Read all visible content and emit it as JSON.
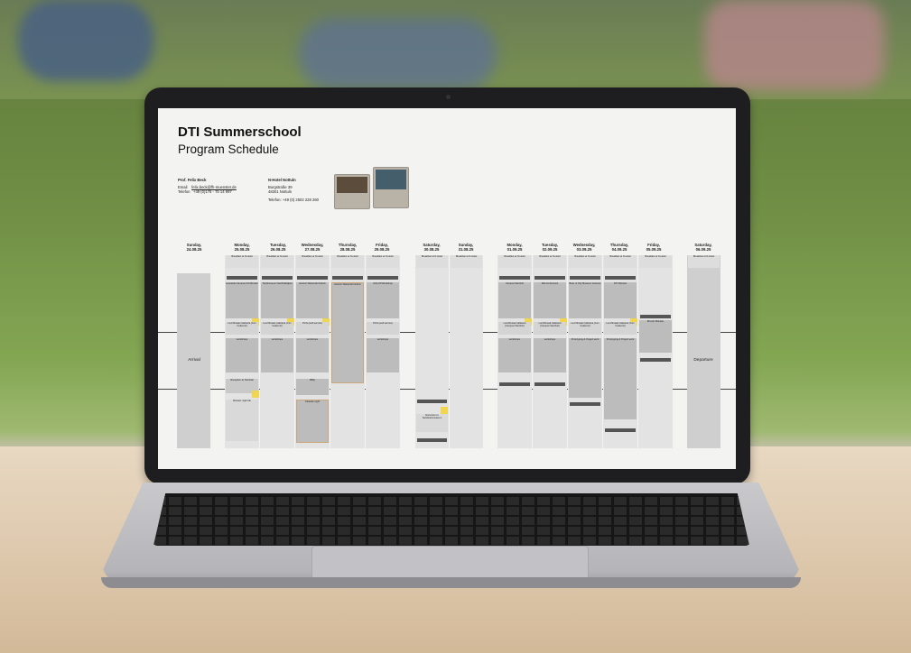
{
  "schedule": {
    "title": "DTI Summerschool",
    "subtitle": "Program Schedule",
    "contact": {
      "name": "Prof. Felix Beck",
      "email_label": "Email",
      "email": "felix.beck@fh-muenster.de",
      "phone_label": "Telefon",
      "phone": "+49 (0)175 - 75 14 997"
    },
    "hotel": {
      "name": "N-Hotel Nottuln",
      "street": "Burgstraße 39",
      "city": "48301 Nottuln",
      "phone": "Telefon: +49 (0) 2502 228 260"
    },
    "days": [
      {
        "label": "Sunday,",
        "date": "24.08.25"
      },
      {
        "label": "Monday,",
        "date": "25.08.25"
      },
      {
        "label": "Tuesday,",
        "date": "26.08.25"
      },
      {
        "label": "Wednesday,",
        "date": "27.08.25"
      },
      {
        "label": "Thursday,",
        "date": "28.08.25"
      },
      {
        "label": "Friday,",
        "date": "29.08.25"
      },
      {
        "label": "Saturday,",
        "date": "30.08.25"
      },
      {
        "label": "Sunday,",
        "date": "31.08.25"
      },
      {
        "label": "Monday,",
        "date": "01.09.25"
      },
      {
        "label": "Tuesday,",
        "date": "02.09.25"
      },
      {
        "label": "Wednesday,",
        "date": "03.09.25"
      },
      {
        "label": "Thursday,",
        "date": "04.09.25"
      },
      {
        "label": "Friday,",
        "date": "05.09.25"
      },
      {
        "label": "Saturday,",
        "date": "06.09.25"
      }
    ],
    "arrival": "Arrival",
    "departure": "Departure",
    "blocks": {
      "breakfast": "Breakfast at N-Hotel",
      "workshops": "workshops",
      "lunch_zum_cedercul": "Lunchbreak Cafeteria (zum Cedercul)",
      "lunch_campus_steinfurt": "Lunchbreak Cafeteria (Campus Steinfurt)",
      "leonardo": "Leonardo-Campus FH Münster",
      "zentrum": "Textilmuseum Nachhaltigkeit",
      "historic": "Historic Weberrati Nottuln",
      "kick_off": "Kick-Off Workshop",
      "bbq": "BBQ",
      "pizza": "Pizza (self service)",
      "welcome_dinner": "Welcome Dinner",
      "reception": "Reception at Townhall",
      "karaoke": "Karaoke night",
      "dinner_stadt": "Dinner at Stadtcafé",
      "dj_night": "Münster night life",
      "excursion": "Excursion to Sandsteinmuseum",
      "campus_steinfurt": "Campus Steinfurt",
      "mid_conference": "Mid-Conference",
      "boot_trip": "Boat- & City Museum Grevens",
      "prototyping": "Prototyping & Project work",
      "tour_lab": "Tour of Robotic Lab",
      "dti_munster": "DTI Münster",
      "brunch": "Brunch Münster",
      "fairwell": "Fairwell Party"
    }
  }
}
